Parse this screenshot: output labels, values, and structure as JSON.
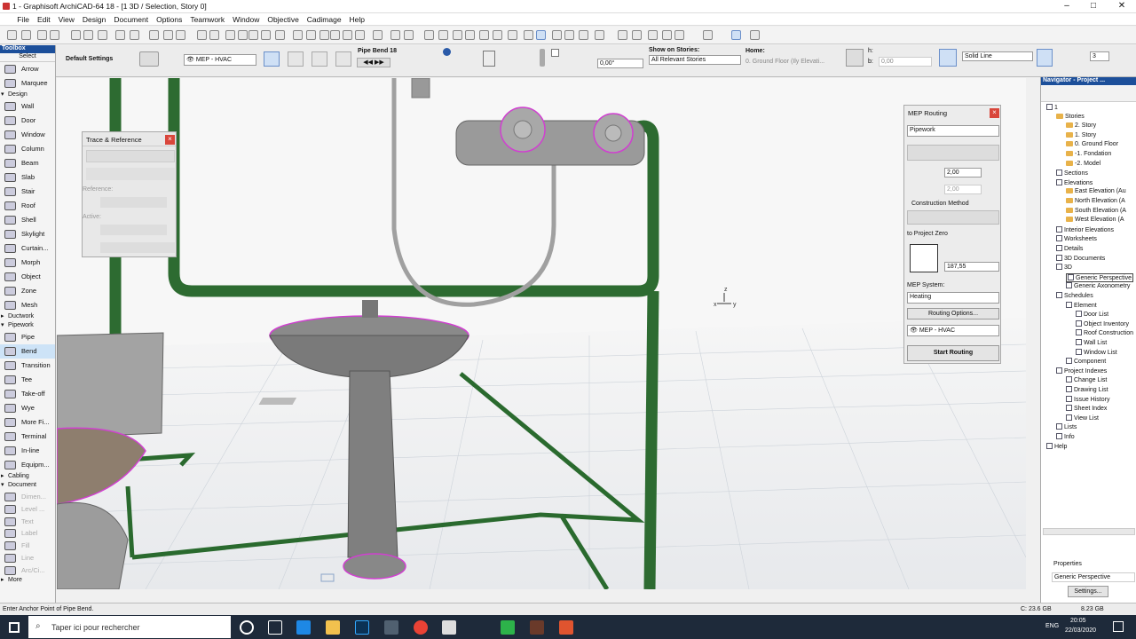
{
  "window": {
    "title": "1 - Graphisoft ArchiCAD-64 18 - [1 3D / Selection, Story 0]",
    "minimize": "–",
    "maximize": "□",
    "close": "✕"
  },
  "menu": [
    "File",
    "Edit",
    "View",
    "Design",
    "Document",
    "Options",
    "Teamwork",
    "Window",
    "Objective",
    "Cadimage",
    "Help"
  ],
  "infobox": {
    "default_settings": "Default Settings",
    "layer": "MEP - HVAC",
    "element_name": "Pipe Bend 18",
    "angle": "0,00°",
    "show_on_stories_label": "Show on Stories:",
    "show_on_stories": "All Relevant Stories",
    "home_label": "Home:",
    "home_value": "0. Ground Floor (Ily Elevati...",
    "h_label": "h:",
    "b_label": "b:",
    "b_value": "0,00",
    "line_type": "Solid Line",
    "pen_number": "3"
  },
  "toolbox": {
    "title": "Toolbox",
    "select": "Select",
    "items_select": [
      "Arrow",
      "Marquee"
    ],
    "design_label": "Design",
    "design": [
      "Wall",
      "Door",
      "Window",
      "Column",
      "Beam",
      "Slab",
      "Stair",
      "Roof",
      "Shell",
      "Skylight",
      "Curtain...",
      "Morph",
      "Object",
      "Zone",
      "Mesh"
    ],
    "ductwork": "Ductwork",
    "pipework_label": "Pipework",
    "pipework": [
      "Pipe",
      "Bend",
      "Transition",
      "Tee",
      "Take-off",
      "Wye",
      "More Fi...",
      "Terminal",
      "In-line",
      "Equipm..."
    ],
    "cabling": "Cabling",
    "document_label": "Document",
    "document": [
      "Dimen...",
      "Level ...",
      "Text",
      "Label",
      "Fill",
      "Line",
      "Arc/Ci..."
    ],
    "more": "More"
  },
  "trace": {
    "title": "Trace & Reference",
    "reference": "Reference:",
    "active": "Active:"
  },
  "axis": {
    "z": "z",
    "x": "x",
    "y": "y"
  },
  "mep": {
    "title": "MEP Routing",
    "type": "Pipework",
    "size1": "2,00",
    "size2": "2,00",
    "construction": "Construction Method",
    "project_zero": "to Project Zero",
    "offset": "187,55",
    "system_label": "MEP System:",
    "system": "Heating",
    "routing_options": "Routing Options...",
    "layer": "MEP - HVAC",
    "start": "Start Routing"
  },
  "navigator": {
    "title": "Navigator - Project ...",
    "tree": [
      "1",
      "Stories",
      "2. Story",
      "1. Story",
      "0. Ground Floor",
      "-1. Fondation",
      "-2. Model",
      "Sections",
      "Elevations",
      "East Elevation (Au",
      "North Elevation (A",
      "South Elevation (A",
      "West Elevation (A",
      "Interior Elevations",
      "Worksheets",
      "Details",
      "3D Documents",
      "3D",
      "Generic Perspective",
      "Generic Axonometry",
      "Schedules",
      "Element",
      "Door List",
      "Object Inventory",
      "Roof Construction",
      "Wall List",
      "Window List",
      "Component",
      "Project Indexes",
      "Change List",
      "Drawing List",
      "Issue History",
      "Sheet Index",
      "View List",
      "Lists",
      "Info",
      "Help"
    ],
    "properties_label": "Properties",
    "properties_value": "Generic Perspective",
    "settings": "Settings..."
  },
  "status": {
    "prompt": "Enter Anchor Point of Pipe Bend.",
    "disk_c": "C: 23.6 GB",
    "ram": "8.23 GB"
  },
  "taskbar": {
    "search": "Taper ici pour rechercher",
    "lang": "ENG",
    "time": "20:05",
    "date": "22/03/2020"
  },
  "colors": {
    "pipe": "#1f5a24",
    "pipe_light": "#2d7a33",
    "fixture": "#8c8c8c",
    "selection": "#d040d0",
    "toolbox_header": "#1c4f9a",
    "taskbar": "#1e2a3a"
  }
}
